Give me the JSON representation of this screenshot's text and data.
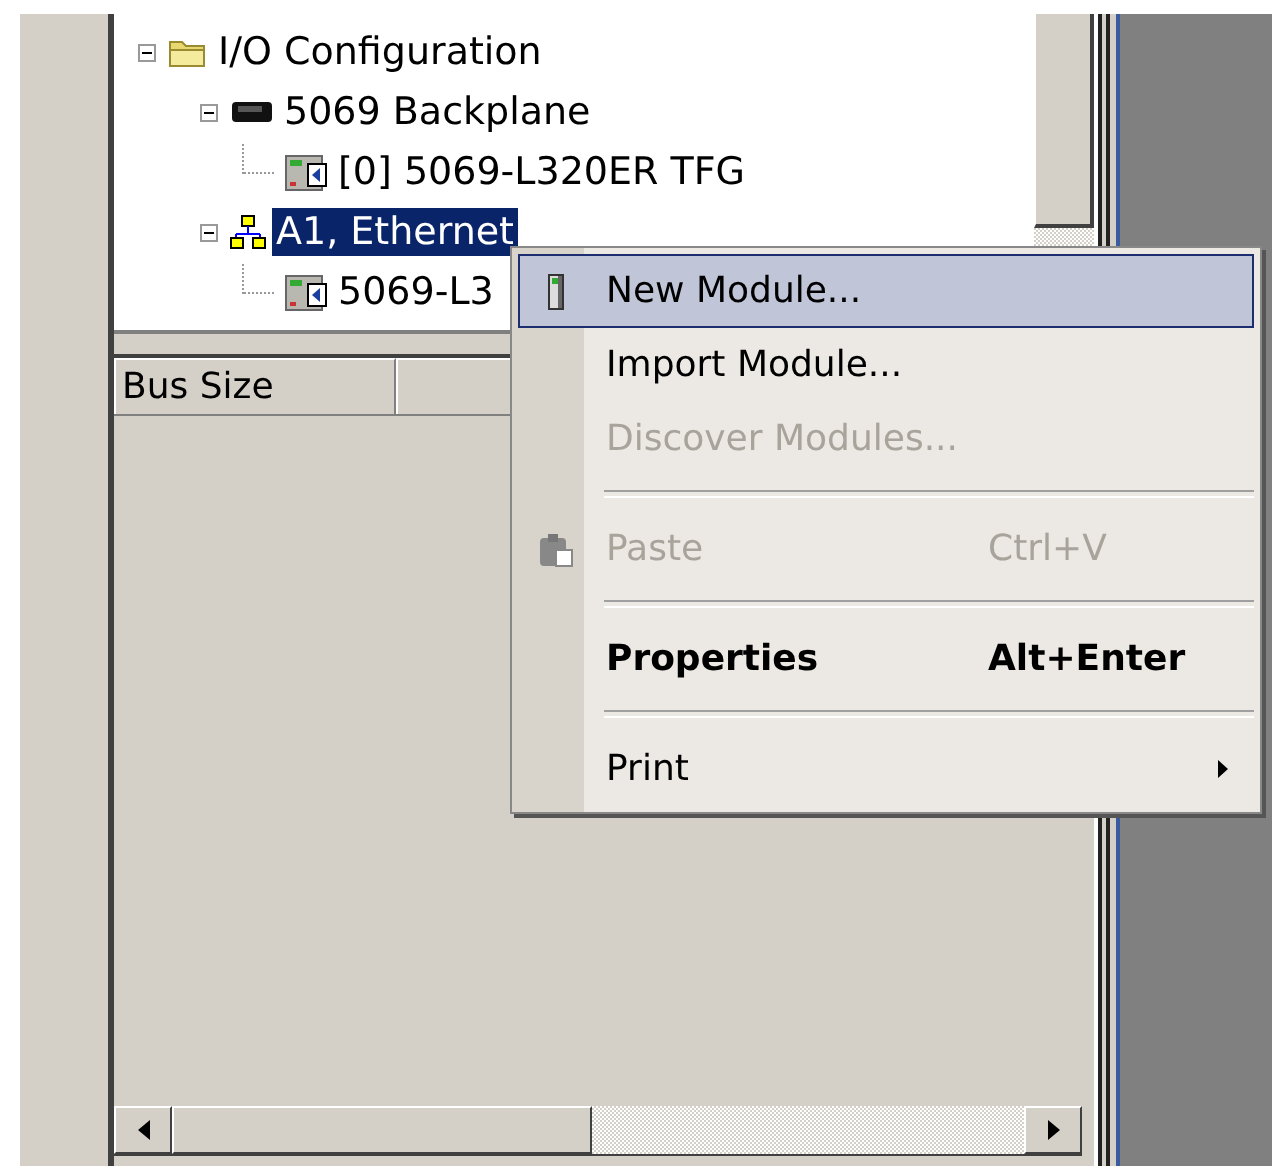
{
  "tree": [
    {
      "label": "I/O Configuration",
      "kind": "folder",
      "expanded": true,
      "selected": false,
      "children": [
        {
          "label": "5069 Backplane",
          "kind": "backplane",
          "expanded": true,
          "selected": false,
          "children": [
            {
              "label": "[0] 5069-L320ER TFG",
              "kind": "module",
              "selected": false
            }
          ]
        },
        {
          "label": "A1, Ethernet",
          "kind": "network",
          "expanded": true,
          "selected": true,
          "children": [
            {
              "label": "5069-L3",
              "kind": "module",
              "selected": false
            }
          ]
        }
      ]
    }
  ],
  "properties": {
    "columns": [
      "Bus Size"
    ]
  },
  "context_menu": {
    "items": [
      {
        "kind": "item",
        "label": "New Module...",
        "selected": true,
        "disabled": false
      },
      {
        "kind": "item",
        "label": "Import Module...",
        "selected": false,
        "disabled": false
      },
      {
        "kind": "item",
        "label": "Discover Modules...",
        "selected": false,
        "disabled": true
      },
      {
        "kind": "separator"
      },
      {
        "kind": "item",
        "label": "Paste",
        "shortcut": "Ctrl+V",
        "selected": false,
        "disabled": true
      },
      {
        "kind": "separator"
      },
      {
        "kind": "item",
        "label": "Properties",
        "shortcut": "Alt+Enter",
        "bold": true,
        "selected": false,
        "disabled": false
      },
      {
        "kind": "separator"
      },
      {
        "kind": "item",
        "label": "Print",
        "submenu": true,
        "selected": false,
        "disabled": false
      }
    ]
  }
}
